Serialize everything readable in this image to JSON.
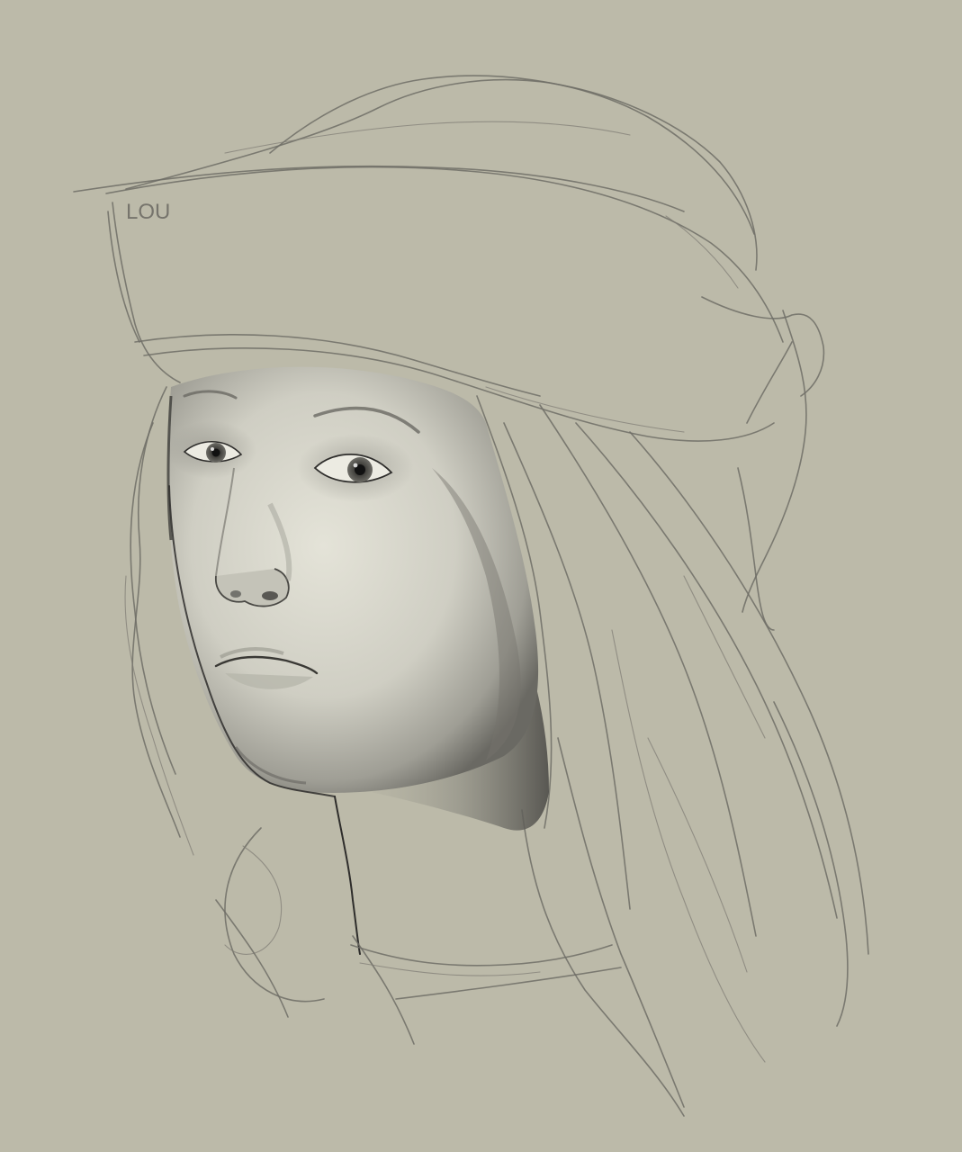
{
  "artwork": {
    "subject": "portrait-sketch",
    "signature_text": "LOU",
    "colors": {
      "background": "#bcbaa9",
      "sketch_line": "#6f6d66",
      "skin_light": "#e2e1d6",
      "skin_mid": "#b9b8ad",
      "skin_shadow": "#5b5a55",
      "ink": "#2e2d2b"
    }
  }
}
